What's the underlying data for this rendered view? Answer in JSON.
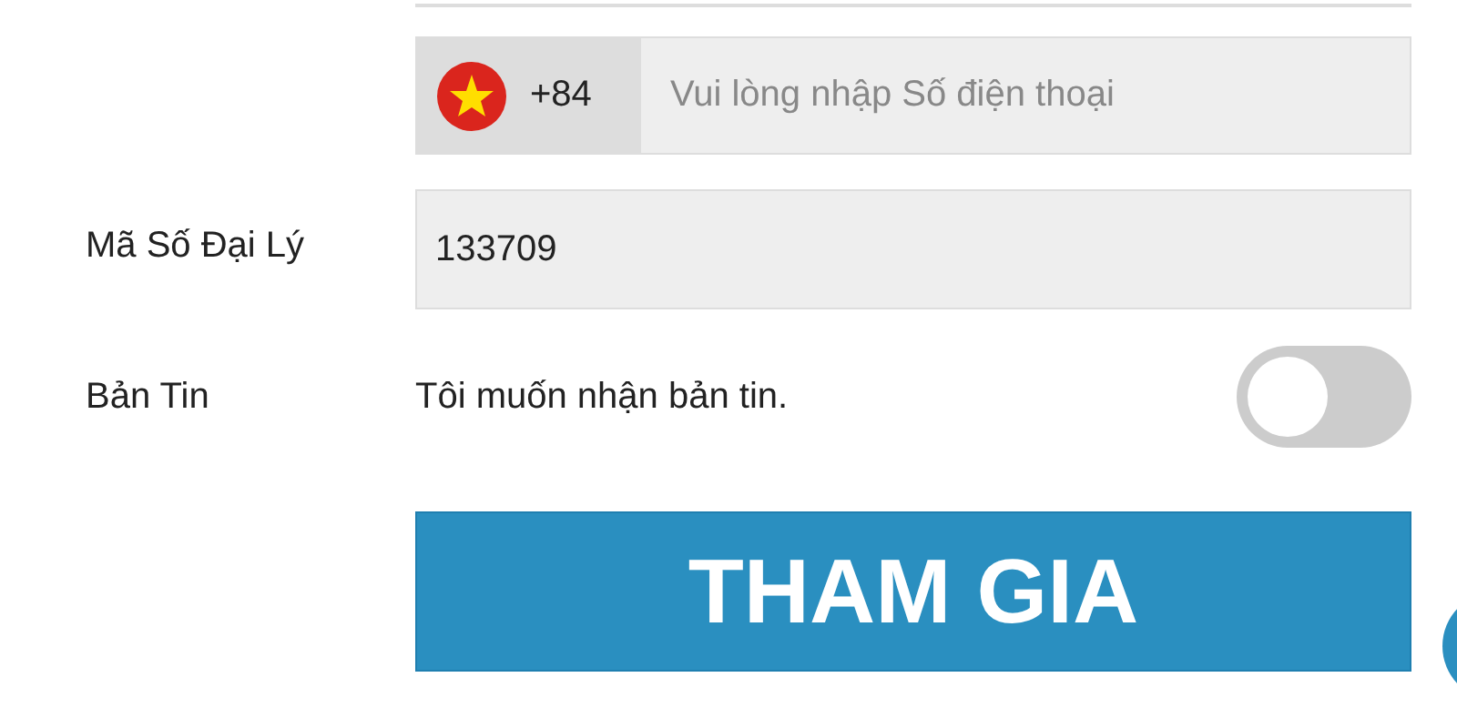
{
  "phone": {
    "country_code": "+84",
    "placeholder": "Vui lòng nhập Số điện thoại"
  },
  "agent_code": {
    "label": "Mã Số Đại Lý",
    "value": "133709"
  },
  "newsletter": {
    "label": "Bản Tin",
    "text": "Tôi muốn nhận bản tin.",
    "on": false
  },
  "submit": {
    "label": "THAM GIA"
  }
}
